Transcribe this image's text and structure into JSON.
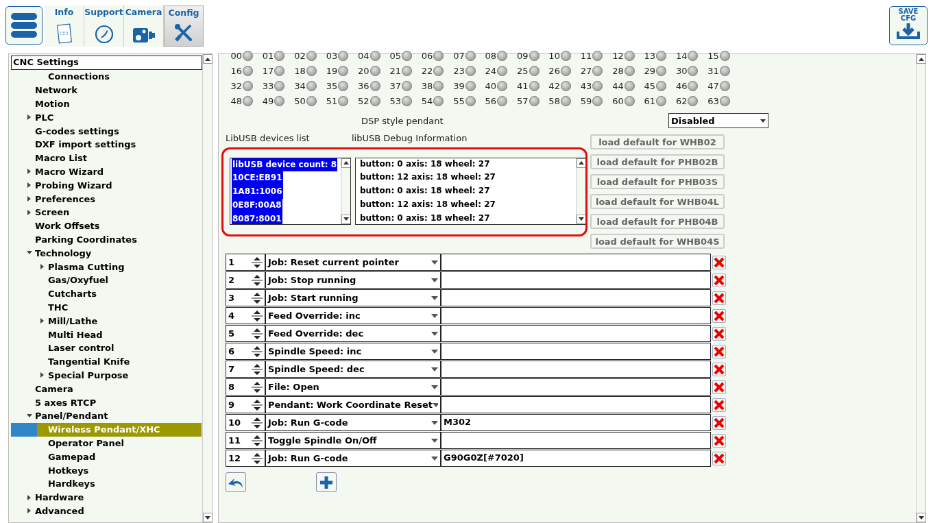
{
  "tabs": [
    {
      "label": "Info",
      "selected": false
    },
    {
      "label": "Support",
      "selected": false
    },
    {
      "label": "Camera",
      "selected": false
    },
    {
      "label": "Config",
      "selected": true
    }
  ],
  "save_button": {
    "label": "SAVE\nCFG"
  },
  "sidebar": {
    "header": "CNC Settings",
    "items": [
      {
        "children": [
          {
            "label": "Connections",
            "selected": false
          }
        ]
      },
      {
        "label": "Network",
        "selected": false
      },
      {
        "label": "Motion",
        "selected": false
      },
      {
        "label": "PLC",
        "expanded": false,
        "selected": false
      },
      {
        "label": "G-codes settings",
        "selected": false
      },
      {
        "label": "DXF import settings",
        "selected": false
      },
      {
        "label": "Macro List",
        "selected": false
      },
      {
        "label": "Macro Wizard",
        "expanded": false,
        "selected": false
      },
      {
        "label": "Probing Wizard",
        "expanded": false,
        "selected": false
      },
      {
        "label": "Preferences",
        "expanded": false,
        "selected": false
      },
      {
        "label": "Screen",
        "expanded": false,
        "selected": false
      },
      {
        "label": "Work Offsets",
        "selected": false
      },
      {
        "label": "Parking Coordinates",
        "selected": false
      },
      {
        "label": "Technology",
        "expanded": true,
        "selected": false,
        "children": [
          {
            "label": "Plasma Cutting",
            "expanded": false,
            "selected": false
          },
          {
            "label": "Gas/Oxyfuel",
            "selected": false
          },
          {
            "label": "Cutcharts",
            "selected": false
          },
          {
            "label": "THC",
            "selected": false
          },
          {
            "label": "Mill/Lathe",
            "expanded": false,
            "selected": false
          },
          {
            "label": "Multi Head",
            "selected": false
          },
          {
            "label": "Laser control",
            "selected": false
          },
          {
            "label": "Tangential Knife",
            "selected": false
          },
          {
            "label": "Special Purpose",
            "expanded": false,
            "selected": false
          }
        ]
      },
      {
        "label": "Camera",
        "selected": false
      },
      {
        "label": "5 axes RTCP",
        "selected": false
      },
      {
        "label": "Panel/Pendant",
        "expanded": true,
        "selected": false,
        "children": [
          {
            "label": "Wireless Pendant/XHC",
            "selected": true
          },
          {
            "label": "Operator Panel",
            "selected": false
          },
          {
            "label": "Gamepad",
            "selected": false
          },
          {
            "label": "Hotkeys",
            "selected": false
          },
          {
            "label": "Hardkeys",
            "selected": false
          }
        ]
      },
      {
        "label": "Hardware",
        "expanded": false,
        "selected": false
      },
      {
        "label": "Advanced",
        "expanded": false,
        "selected": false
      }
    ]
  },
  "leds": [
    {
      "label": "00",
      "on": false
    },
    {
      "label": "01",
      "on": false
    },
    {
      "label": "02",
      "on": false
    },
    {
      "label": "03",
      "on": false
    },
    {
      "label": "04",
      "on": false
    },
    {
      "label": "05",
      "on": false
    },
    {
      "label": "06",
      "on": false
    },
    {
      "label": "07",
      "on": false
    },
    {
      "label": "08",
      "on": false
    },
    {
      "label": "09",
      "on": false
    },
    {
      "label": "10",
      "on": false
    },
    {
      "label": "11",
      "on": false
    },
    {
      "label": "12",
      "on": false
    },
    {
      "label": "13",
      "on": false
    },
    {
      "label": "14",
      "on": false
    },
    {
      "label": "15",
      "on": false
    },
    {
      "label": "16",
      "on": false
    },
    {
      "label": "17",
      "on": false
    },
    {
      "label": "18",
      "on": false
    },
    {
      "label": "19",
      "on": false
    },
    {
      "label": "20",
      "on": false
    },
    {
      "label": "21",
      "on": false
    },
    {
      "label": "22",
      "on": false
    },
    {
      "label": "23",
      "on": false
    },
    {
      "label": "24",
      "on": false
    },
    {
      "label": "25",
      "on": false
    },
    {
      "label": "26",
      "on": false
    },
    {
      "label": "27",
      "on": false
    },
    {
      "label": "28",
      "on": false
    },
    {
      "label": "29",
      "on": false
    },
    {
      "label": "30",
      "on": false
    },
    {
      "label": "31",
      "on": false
    },
    {
      "label": "32",
      "on": false
    },
    {
      "label": "33",
      "on": false
    },
    {
      "label": "34",
      "on": false
    },
    {
      "label": "35",
      "on": false
    },
    {
      "label": "36",
      "on": false
    },
    {
      "label": "37",
      "on": false
    },
    {
      "label": "38",
      "on": false
    },
    {
      "label": "39",
      "on": false
    },
    {
      "label": "40",
      "on": false
    },
    {
      "label": "41",
      "on": false
    },
    {
      "label": "42",
      "on": false
    },
    {
      "label": "43",
      "on": false
    },
    {
      "label": "44",
      "on": false
    },
    {
      "label": "45",
      "on": false
    },
    {
      "label": "46",
      "on": false
    },
    {
      "label": "47",
      "on": false
    },
    {
      "label": "48",
      "on": false
    },
    {
      "label": "49",
      "on": false
    },
    {
      "label": "50",
      "on": false
    },
    {
      "label": "51",
      "on": false
    },
    {
      "label": "52",
      "on": false
    },
    {
      "label": "53",
      "on": false
    },
    {
      "label": "54",
      "on": false
    },
    {
      "label": "55",
      "on": false
    },
    {
      "label": "56",
      "on": false
    },
    {
      "label": "57",
      "on": false
    },
    {
      "label": "58",
      "on": false
    },
    {
      "label": "59",
      "on": false
    },
    {
      "label": "60",
      "on": false
    },
    {
      "label": "61",
      "on": false
    },
    {
      "label": "62",
      "on": false
    },
    {
      "label": "63",
      "on": false
    }
  ],
  "dsp_style_pendant": {
    "label": "DSP style pendant",
    "value": "Disabled"
  },
  "devices_list": {
    "label": "LibUSB devices list",
    "items": [
      {
        "text": "libUSB device count: 8",
        "selected": true
      },
      {
        "text": "10CE:EB91",
        "selected": true
      },
      {
        "text": "1A81:1006",
        "selected": true
      },
      {
        "text": "0E8F:00A8",
        "selected": true
      },
      {
        "text": "8087:8001",
        "selected": true
      }
    ]
  },
  "debug_info": {
    "label": "libUSB Debug Information",
    "lines": [
      "button: 0 axis: 18 wheel: 27",
      "button: 12 axis: 18 wheel: 27",
      "button: 0 axis: 18 wheel: 27",
      "button: 12 axis: 18 wheel: 27",
      "button: 0 axis: 18 wheel: 27"
    ]
  },
  "load_default_buttons": [
    "load default for WHB02",
    "load default for PHB02B",
    "load default for PHB03S",
    "load default for WHB04L",
    "load default for PHB04B",
    "load default for WHB04S"
  ],
  "mappings": [
    {
      "number": "1",
      "action": "Job: Reset current pointer"
    },
    {
      "number": "2",
      "action": "Job: Stop running"
    },
    {
      "number": "3",
      "action": "Job: Start running"
    },
    {
      "number": "4",
      "action": "Feed Override: inc"
    },
    {
      "number": "5",
      "action": "Feed Override: dec"
    },
    {
      "number": "6",
      "action": "Spindle Speed: inc"
    },
    {
      "number": "7",
      "action": "Spindle Speed: dec"
    },
    {
      "number": "8",
      "action": "File: Open"
    },
    {
      "number": "9",
      "action": "Pendant: Work Coordinate Reset"
    },
    {
      "number": "10",
      "action": "Job: Run G-code",
      "parameter": "M302"
    },
    {
      "number": "11",
      "action": "Toggle Spindle On/Off"
    },
    {
      "number": "12",
      "action": "Job: Run G-code",
      "parameter": "G90G0Z[#7020]"
    }
  ]
}
